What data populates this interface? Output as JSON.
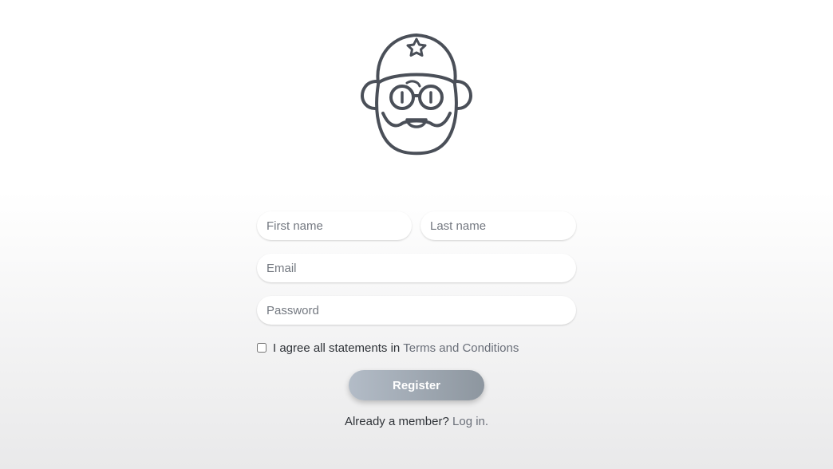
{
  "logo": {
    "icon": "bearded-man-with-cap-icon",
    "color": "#4a4f58"
  },
  "form": {
    "first_name_placeholder": "First name",
    "last_name_placeholder": "Last name",
    "email_placeholder": "Email",
    "password_placeholder": "Password",
    "first_name_value": "",
    "last_name_value": "",
    "email_value": "",
    "password_value": "",
    "agree_checked": false,
    "agree_text": "I agree all statements in",
    "terms_link": "Terms and Conditions",
    "register_label": "Register"
  },
  "footer": {
    "member_text": "Already a member?",
    "login_link": "Log in",
    "login_suffix": "."
  },
  "colors": {
    "icon": "#4a4f58",
    "link": "#6a6f79",
    "button_gradient_start": "#b3bcc7",
    "button_gradient_end": "#8d969f"
  }
}
